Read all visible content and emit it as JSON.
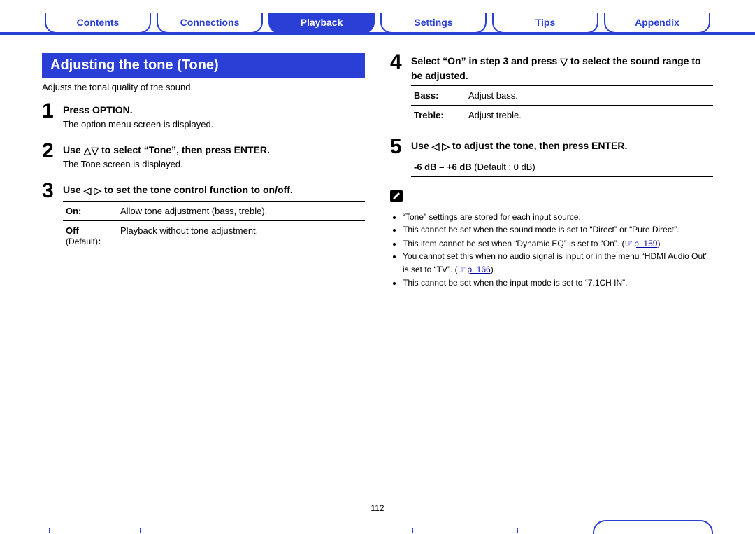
{
  "nav": {
    "tabs": [
      {
        "label": "Contents",
        "active": false
      },
      {
        "label": "Connections",
        "active": false
      },
      {
        "label": "Playback",
        "active": true
      },
      {
        "label": "Settings",
        "active": false
      },
      {
        "label": "Tips",
        "active": false
      },
      {
        "label": "Appendix",
        "active": false
      }
    ]
  },
  "heading": "Adjusting the tone (Tone)",
  "lead": "Adjusts the tonal quality of the sound.",
  "steps": {
    "s1": {
      "num": "1",
      "head": "Press OPTION.",
      "sub": "The option menu screen is displayed."
    },
    "s2": {
      "num": "2",
      "head_a": "Use ",
      "head_arrow": "△▽",
      "head_b": " to select “Tone”, then press ENTER.",
      "sub": "The Tone screen is displayed."
    },
    "s3": {
      "num": "3",
      "head_a": "Use ",
      "head_arrow": "◁ ▷",
      "head_b": " to set the tone control function to on/off."
    },
    "s4": {
      "num": "4",
      "head_a": "Select “On” in step 3 and press ",
      "head_arrow": "▽",
      "head_b": " to select the sound range to be adjusted."
    },
    "s5": {
      "num": "5",
      "head_a": "Use ",
      "head_arrow": "◁ ▷",
      "head_b": " to adjust the tone, then press ENTER."
    }
  },
  "table_onoff": {
    "on_k": "On:",
    "on_v": "Allow tone adjustment (bass, treble).",
    "off_k": "Off",
    "off_default": "(Default)",
    "off_colon": ":",
    "off_v": "Playback without tone adjustment."
  },
  "table_bt": {
    "bass_k": "Bass:",
    "bass_v": "Adjust bass.",
    "treble_k": "Treble:",
    "treble_v": "Adjust treble."
  },
  "range": {
    "value": "-6 dB – +6 dB",
    "default": " (Default : 0 dB)"
  },
  "notes": {
    "n1": "“Tone” settings are stored for each input source.",
    "n2": "This cannot be set when the sound mode is set to “Direct” or “Pure Direct”.",
    "n3_a": "This item cannot be set when “Dynamic EQ” is set to “On”. (",
    "n3_link": "p. 159",
    "n3_b": ")",
    "n4_a": "You cannot set this when no audio signal is input or in the menu “HDMI Audio Out” is set to “TV”. (",
    "n4_link": "p. 166",
    "n4_b": ")",
    "n5": "This cannot be set when the input mode is set to “7.1CH IN”."
  },
  "page_number": "112"
}
